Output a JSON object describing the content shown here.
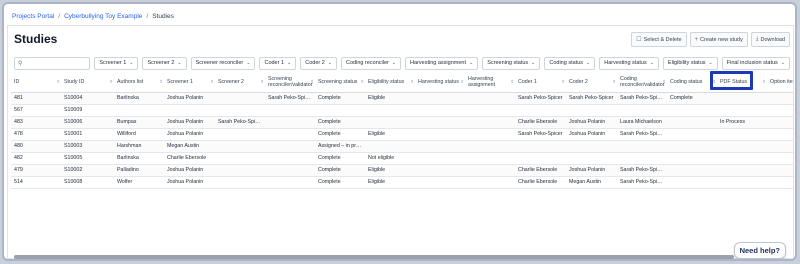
{
  "breadcrumb": [
    "Projects Portal",
    "Cyberbullying Toy Example",
    "Studies"
  ],
  "page_title": "Studies",
  "actions": {
    "select_delete": "Select & Delete",
    "create_new": "Create new study",
    "download": "Download"
  },
  "search": {
    "placeholder": ""
  },
  "filters": [
    "Screener 1",
    "Screener 2",
    "Screener reconciler",
    "Coder 1",
    "Coder 2",
    "Coding reconciler",
    "Harvesting assignment",
    "Screening status",
    "Coding status",
    "Harvesting status",
    "Eligibility status",
    "Final inclusion status"
  ],
  "columns": [
    "ID",
    "Study ID",
    "Authors list",
    "Screener 1",
    "Screener 2",
    "Screening reconciler/validator",
    "Screening status",
    "Eligibility status",
    "Harvesting status",
    "Harvesting assignment",
    "Coder 1",
    "Coder 2",
    "Coding reconciler/validator",
    "Coding status",
    "PDF Status",
    "Option item"
  ],
  "rows": [
    [
      "481",
      "S10004",
      "Barlinska",
      "Joshua Polanin",
      "",
      "Sarah Peko-Spicer",
      "Complete",
      "Eligible",
      "",
      "",
      "Sarah Peko-Spicer",
      "Sarah Peko-Spicer",
      "Sarah Peko-Spicer",
      "Complete",
      "",
      ""
    ],
    [
      "567",
      "S10009",
      "",
      "",
      "",
      "",
      "",
      "",
      "",
      "",
      "",
      "",
      "",
      "",
      "",
      ""
    ],
    [
      "483",
      "S10006",
      "Bumpas",
      "Joshua Polanin",
      "Sarah Peko-Spicer",
      "",
      "Complete",
      "",
      "",
      "",
      "Charlie Ebersole",
      "Joshua Polanin",
      "Laura Michaelson",
      "",
      "In Process",
      ""
    ],
    [
      "478",
      "S10001",
      "Williford",
      "Joshua Polanin",
      "",
      "",
      "Complete",
      "Eligible",
      "",
      "",
      "Sarah Peko-Spicer",
      "Joshua Polanin",
      "Sarah Peko-Spicer",
      "",
      "",
      ""
    ],
    [
      "480",
      "S10003",
      "Harshman",
      "Megan Austin",
      "",
      "",
      "Assigned – in pro...",
      "",
      "",
      "",
      "",
      "",
      "",
      "",
      "",
      ""
    ],
    [
      "482",
      "S10005",
      "Barlinska",
      "Charlie Ebersole",
      "",
      "",
      "Complete",
      "Not eligible",
      "",
      "",
      "",
      "",
      "",
      "",
      "",
      ""
    ],
    [
      "479",
      "S10002",
      "Palladino",
      "Joshua Polanin",
      "",
      "",
      "Complete",
      "Eligible",
      "",
      "",
      "Charlie Ebersole",
      "Joshua Polanin",
      "Sarah Peko-Spicer",
      "",
      "",
      ""
    ],
    [
      "514",
      "S10008",
      "Wolfer",
      "Joshua Polanin",
      "",
      "",
      "Complete",
      "Eligible",
      "",
      "",
      "Charlie Ebersole",
      "Megan Austin",
      "Sarah Peko-Spicer",
      "",
      "",
      ""
    ]
  ],
  "help_button": "Need help?",
  "colors": {
    "link": "#2563eb",
    "highlight": "#1a3bb3"
  }
}
